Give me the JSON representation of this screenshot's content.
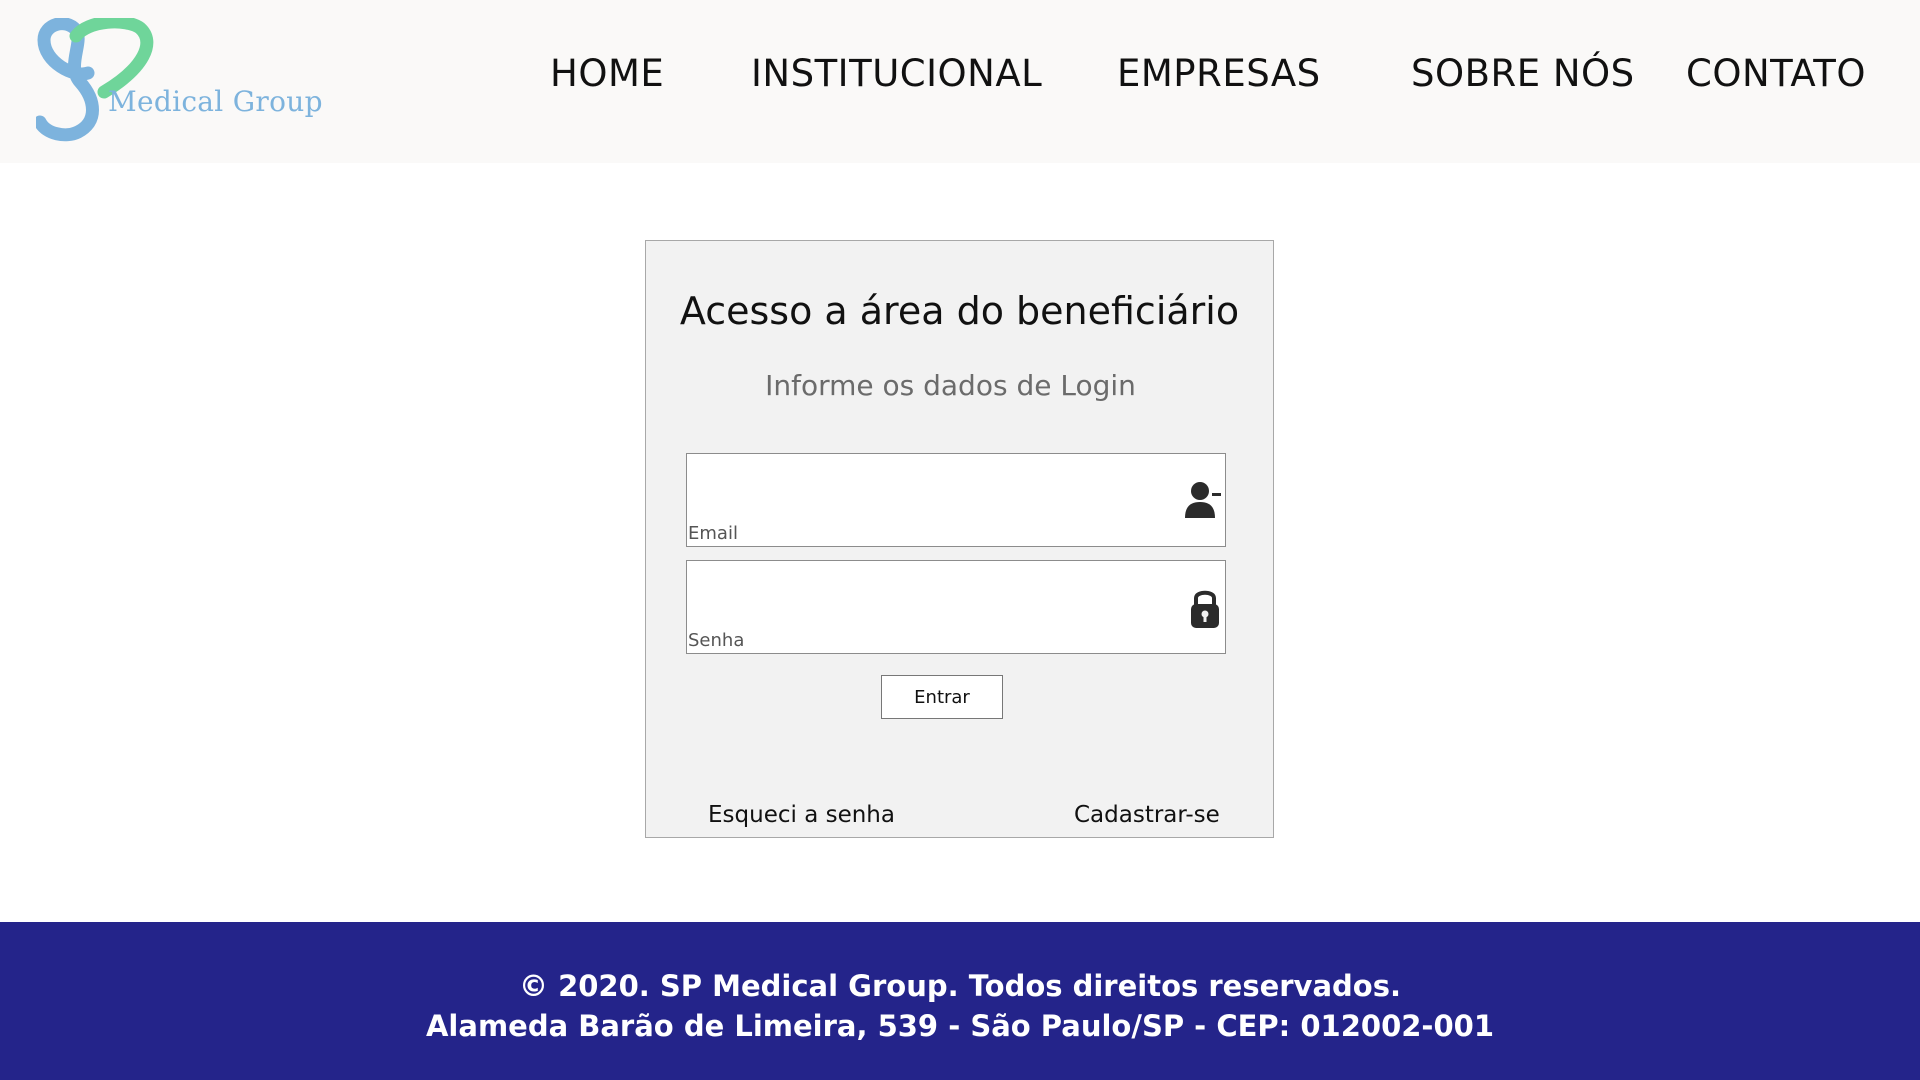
{
  "brand": {
    "logo_text": "Medical Group",
    "logo_colors": {
      "blue": "#7db3dd",
      "green": "#6fd59a"
    }
  },
  "nav": {
    "items": [
      {
        "label": "HOME"
      },
      {
        "label": "INSTITUCIONAL"
      },
      {
        "label": "EMPRESAS"
      },
      {
        "label": "SOBRE NÓS"
      },
      {
        "label": "CONTATO"
      }
    ]
  },
  "login": {
    "title": "Acesso a área do beneficiário",
    "subtitle": "Informe os dados de Login",
    "email": {
      "label": "Email",
      "value": "",
      "icon": "user-icon"
    },
    "password": {
      "label": "Senha",
      "value": "",
      "icon": "lock-icon"
    },
    "submit_label": "Entrar",
    "forgot_label": "Esqueci a senha",
    "signup_label": "Cadastrar-se"
  },
  "footer": {
    "line1": "© 2020. SP Medical Group. Todos direitos reservados.",
    "line2": "Alameda Barão de Limeira, 539 - São Paulo/SP - CEP: 012002-001",
    "background": "#24248a"
  }
}
